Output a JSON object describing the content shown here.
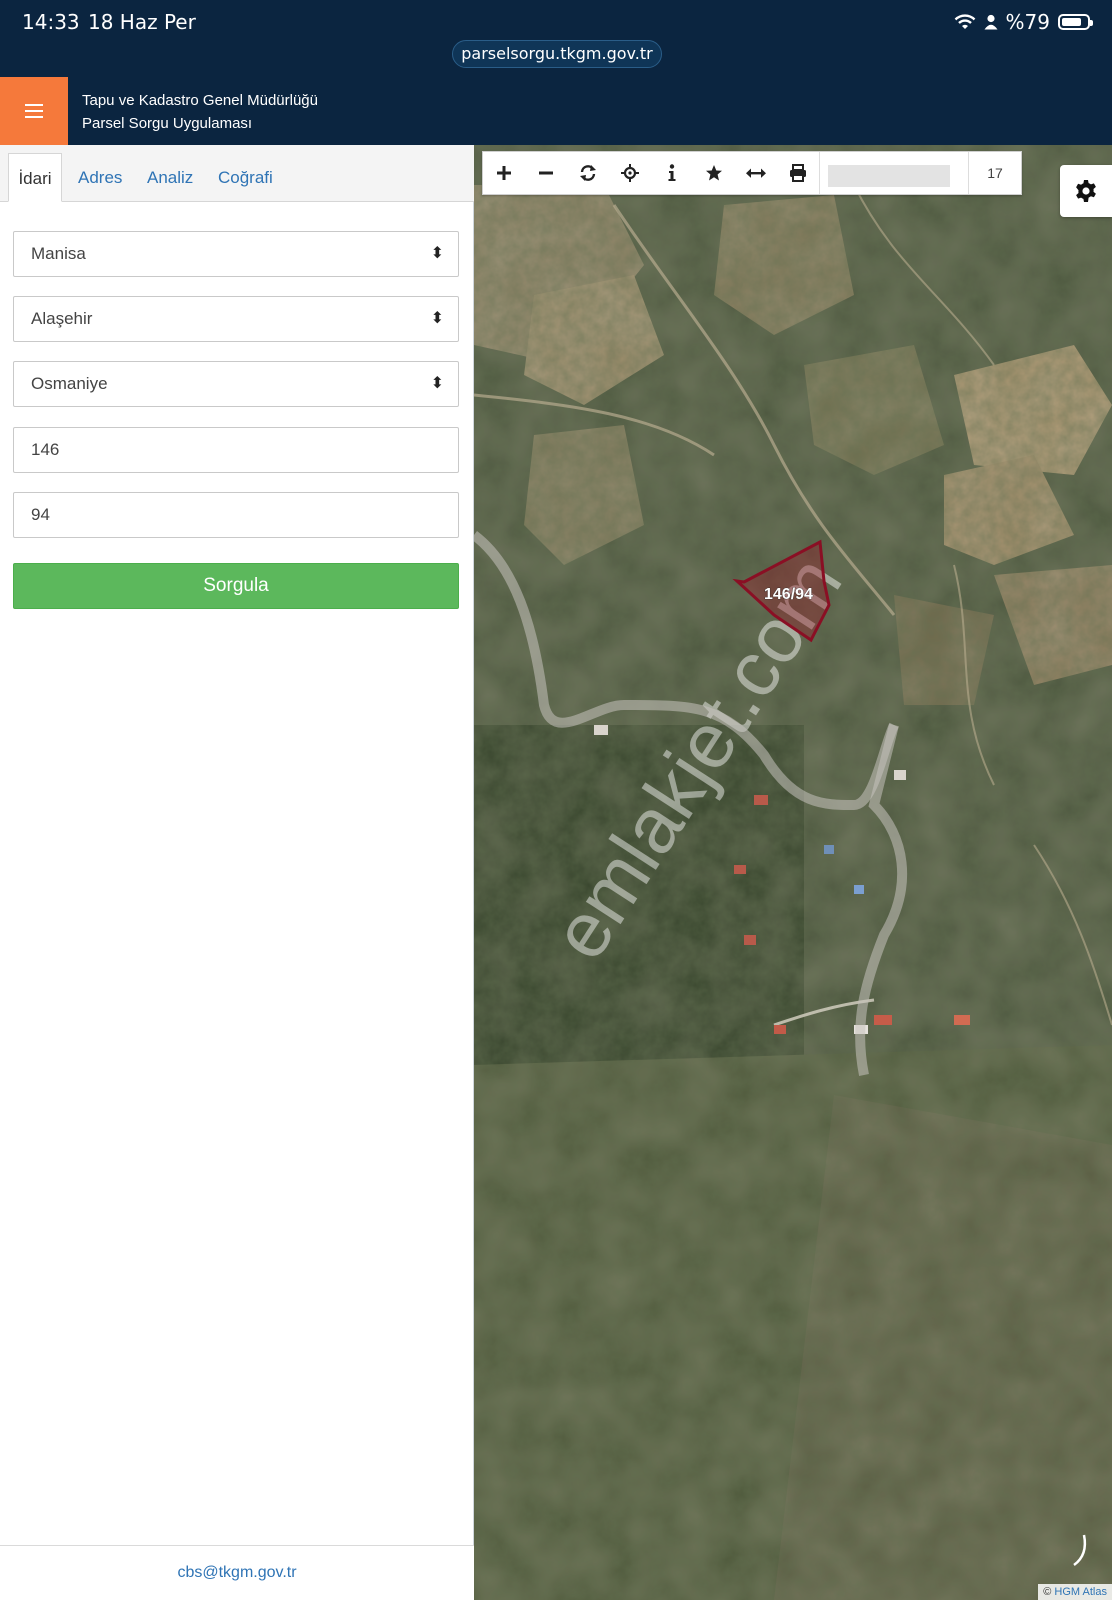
{
  "status_bar": {
    "time": "14:33",
    "date": "18 Haz Per",
    "battery": "%79",
    "battery_fraction": 0.79
  },
  "browser": {
    "url": "parselsorgu.tkgm.gov.tr"
  },
  "header": {
    "title_line1": "Tapu ve Kadastro Genel Müdürlüğü",
    "title_line2": "Parsel Sorgu Uygulaması",
    "menu_icon": "hamburger-icon",
    "accent_color": "#f5793b"
  },
  "tabs": [
    {
      "label": "İdari"
    },
    {
      "label": "Adres"
    },
    {
      "label": "Analiz"
    },
    {
      "label": "Coğrafi"
    }
  ],
  "form": {
    "il": "Manisa",
    "ilce": "Alaşehir",
    "mahalle": "Osmaniye",
    "ada": "146",
    "parsel": "94",
    "submit_label": "Sorgula"
  },
  "footer": {
    "email": "cbs@tkgm.gov.tr"
  },
  "map": {
    "toolbar_icons": [
      "zoom-in-icon",
      "zoom-out-icon",
      "refresh-icon",
      "locate-icon",
      "info-icon",
      "favorite-icon",
      "measure-icon",
      "print-icon"
    ],
    "zoom_level": "17",
    "parcel_label": "146/94",
    "watermark": "emlakjet.com",
    "attribution_prefix": "©",
    "attribution": "HGM Atlas"
  }
}
